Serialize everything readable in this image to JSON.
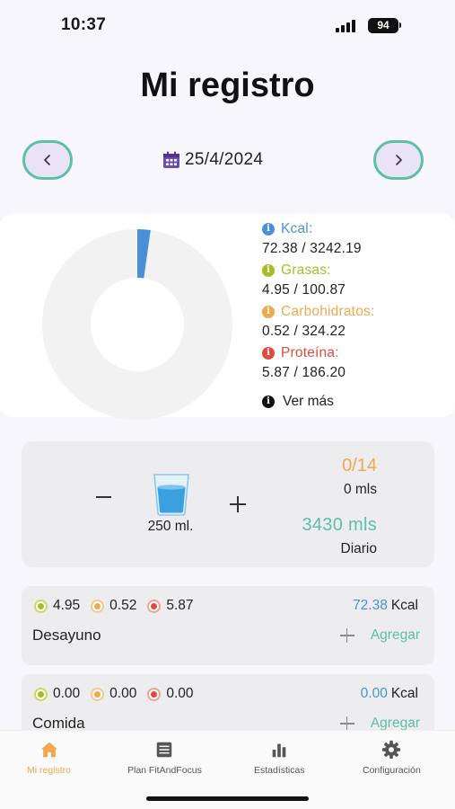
{
  "status_bar": {
    "time": "10:37",
    "battery": "94"
  },
  "page_title": "Mi registro",
  "date_nav": {
    "date": "25/4/2024",
    "prev_label": "<",
    "next_label": ">"
  },
  "macros": {
    "kcal": {
      "label": "Kcal:",
      "value": "72.38 / 3242.19",
      "consumed": 72.38,
      "goal": 3242.19
    },
    "grasas": {
      "label": "Grasas:",
      "value": "4.95 / 100.87"
    },
    "carbohidratos": {
      "label": "Carbohidratos:",
      "value": "0.52 / 324.22"
    },
    "proteina": {
      "label": "Proteína:",
      "value": "5.87 / 186.20"
    },
    "ver_mas": "Ver más",
    "info_glyph": "i"
  },
  "water": {
    "glass_label": "250 ml.",
    "count": "0/14",
    "mls": "0 mls",
    "goal": "3430 mls",
    "period": "Diario"
  },
  "meals": [
    {
      "name": "Desayuno",
      "grasas": "4.95",
      "carbs": "0.52",
      "proteina": "5.87",
      "kcal": "72.38",
      "kcal_unit": "Kcal",
      "add_label": "Agregar"
    },
    {
      "name": "Comida",
      "grasas": "0.00",
      "carbs": "0.00",
      "proteina": "0.00",
      "kcal": "0.00",
      "kcal_unit": "Kcal",
      "add_label": "Agregar"
    }
  ],
  "tabs": [
    {
      "label": "Mi registro",
      "icon": "home-icon",
      "active": true
    },
    {
      "label": "Plan FitAndFocus",
      "icon": "plan-icon",
      "active": false
    },
    {
      "label": "Estadísticas",
      "icon": "stats-icon",
      "active": false
    },
    {
      "label": "Configuración",
      "icon": "gear-icon",
      "active": false
    }
  ],
  "colors": {
    "kcal": "#4a90d9",
    "grasas": "#a8bc2a",
    "carbohidratos": "#f0a84e",
    "proteina": "#dd4b3e",
    "accent": "#5cbfa6"
  }
}
